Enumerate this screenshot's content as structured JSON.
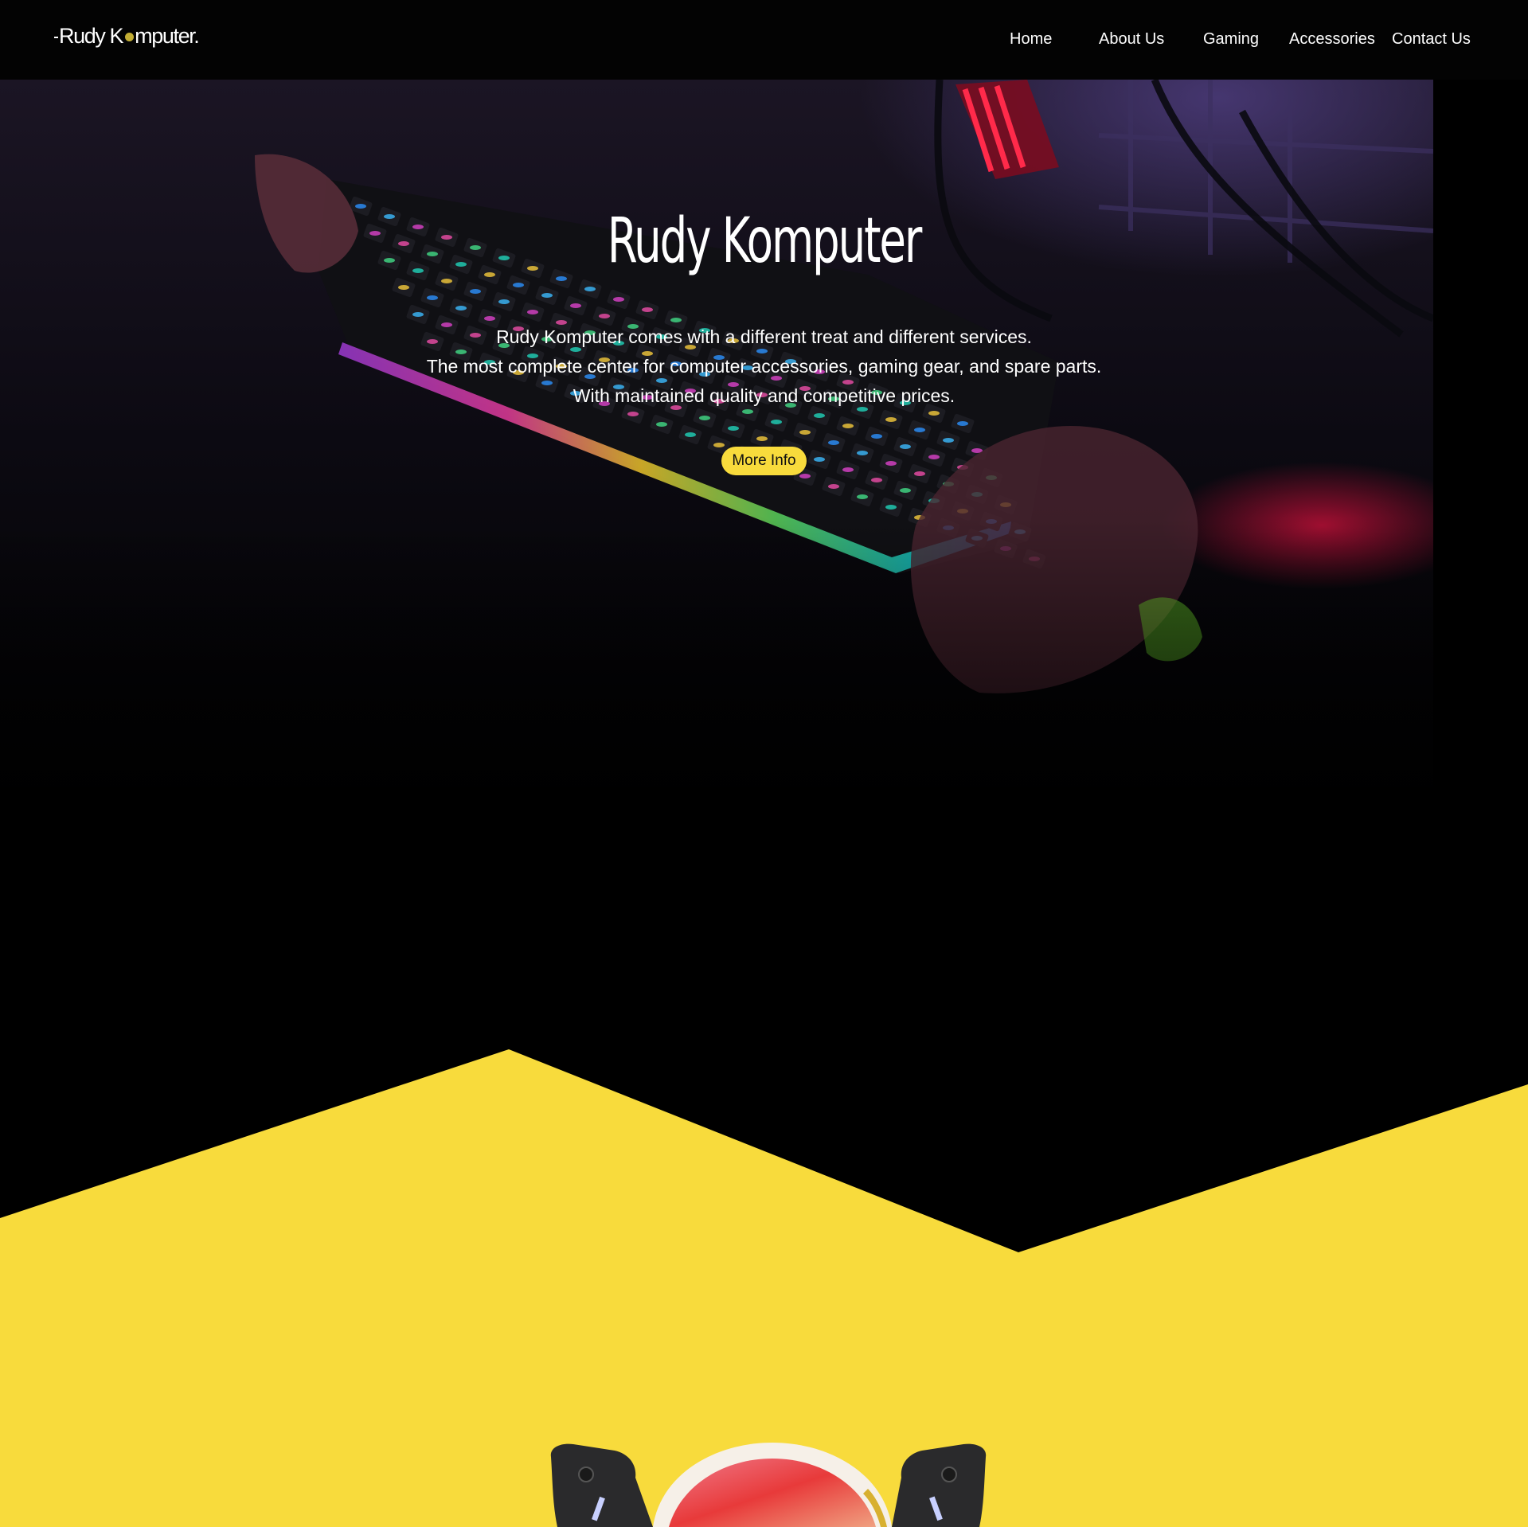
{
  "navbar": {
    "logo": {
      "part1": "Rudy K",
      "part2": "mputer."
    },
    "links": {
      "home": "Home",
      "about": "About Us",
      "gaming": "Gaming",
      "accessories": "Accessories",
      "contact": "Contact Us"
    }
  },
  "hero": {
    "title": "Rudy Komputer",
    "description": {
      "line1": "Rudy Komputer comes with a different treat and different services.",
      "line2": "The most complete center for computer accessories, gaming gear, and spare parts.",
      "line3": "With maintained quality and competitive prices."
    },
    "button_label": "More Info",
    "background_image": "rgb-gaming-keyboard-photo"
  },
  "product_section": {
    "image": "rgb-cooling-fan-photo"
  },
  "colors": {
    "accent_yellow": "#f8db3c",
    "navbar_background": "#030303",
    "page_background": "#000000",
    "text_primary": "#ffffff",
    "logo_dot": "#c2ad34"
  }
}
